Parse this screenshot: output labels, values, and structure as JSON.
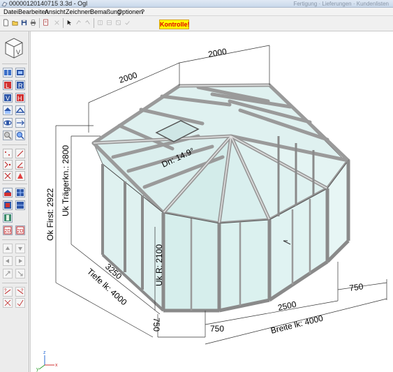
{
  "window": {
    "title": "00000120140715 3.3d - Ogl",
    "title_extra": "Fertigung · Lieferungen · Kundenlisten"
  },
  "menu": [
    "Datei",
    "Bearbeiten",
    "Ansicht",
    "Zeichnen",
    "Bemaßung",
    "Optionen",
    "?"
  ],
  "toolbar": {
    "buttons": [
      "new-icon",
      "open-icon",
      "save-icon",
      "print-icon",
      "page-icon",
      "delete-icon",
      "select-icon",
      "rotate-left-icon",
      "rotate-right-icon",
      "grid-a-icon",
      "grid-b-icon",
      "grid-c-icon",
      "check-icon"
    ],
    "kontrolle_label": "Kontrolle!",
    "kontrolle_bg": "#ffff00",
    "kontrolle_fg": "#e00000"
  },
  "view_cube_label": "V",
  "dimensions": {
    "top_length_a": "2000",
    "top_length_b": "2000",
    "ok_first": "Ok First: 2922",
    "uk_traeger": "Uk Trägerkn.: 2800",
    "uk_r": "Uk R: 2100",
    "roof_angle": "Dn: 14.9°",
    "depth_offset": "3250",
    "tiefe": "Tiefe lk: 4000",
    "side_750_left": "750",
    "bottom_750_left": "750",
    "bottom_2500": "2500",
    "bottom_750_right": "750",
    "breite": "Breite lk: 4000"
  },
  "axes": {
    "x": "x",
    "y": "y",
    "z": "z"
  },
  "colors": {
    "glass": "#d9efef",
    "frame": "#b8b8b8",
    "frame_dark": "#6f6f6f",
    "accent": "#2a6bd6"
  }
}
